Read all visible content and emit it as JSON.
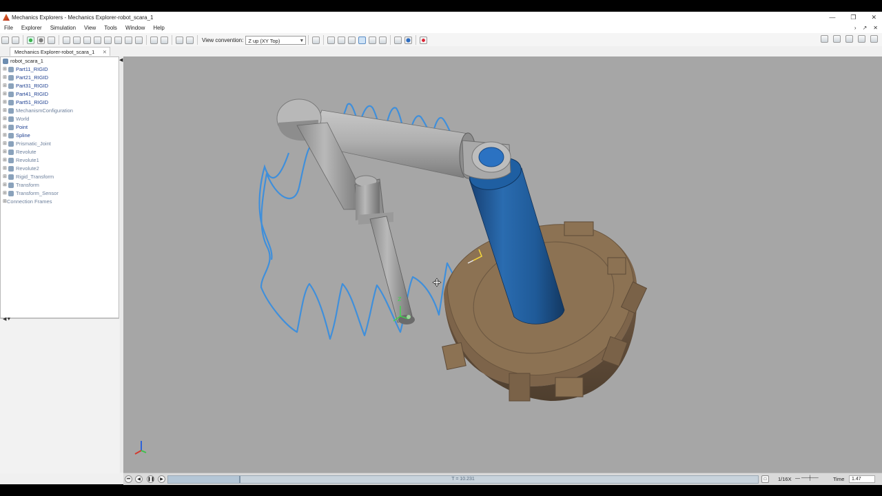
{
  "window": {
    "title": "Mechanics Explorers - Mechanics Explorer-robot_scara_1"
  },
  "menu": {
    "items": [
      "File",
      "Explorer",
      "Simulation",
      "View",
      "Tools",
      "Window",
      "Help"
    ]
  },
  "toolbar": {
    "view_convention_label": "View convention:",
    "view_convention_value": "Z up (XY Top)"
  },
  "tab": {
    "label": "Mechanics Explorer-robot_scara_1"
  },
  "tree": {
    "root": "robot_scara_1",
    "items": [
      {
        "label": "Part11_RIGID",
        "icon": "rigid-body-icon"
      },
      {
        "label": "Part21_RIGID",
        "icon": "rigid-body-icon"
      },
      {
        "label": "Part31_RIGID",
        "icon": "rigid-body-icon"
      },
      {
        "label": "Part41_RIGID",
        "icon": "rigid-body-icon"
      },
      {
        "label": "Part51_RIGID",
        "icon": "rigid-body-icon"
      },
      {
        "label": "MechanismConfiguration",
        "icon": "mechanism-config-icon"
      },
      {
        "label": "World",
        "icon": "world-frame-icon"
      },
      {
        "label": "Point",
        "icon": "point-icon"
      },
      {
        "label": "Spline",
        "icon": "spline-icon"
      },
      {
        "label": "Prismatic_Joint",
        "icon": "prismatic-joint-icon"
      },
      {
        "label": "Revolute",
        "icon": "revolute-joint-icon"
      },
      {
        "label": "Revolute1",
        "icon": "revolute-joint-icon"
      },
      {
        "label": "Revolute2",
        "icon": "revolute-joint-icon"
      },
      {
        "label": "Rigid_Transform",
        "icon": "rigid-transform-icon"
      },
      {
        "label": "Transform",
        "icon": "transform-icon"
      },
      {
        "label": "Transform_Sensor",
        "icon": "transform-sensor-icon"
      },
      {
        "label": "Connection Frames",
        "icon": ""
      }
    ]
  },
  "viewport": {
    "triad_label": "Z",
    "colors": {
      "background": "#a6a6a6",
      "arm": "#a9a9a9",
      "column": "#1f5fa2",
      "gear": "#8c7253",
      "trajectory": "#3f8fdb"
    }
  },
  "playback": {
    "slider_text": "T = 10.231",
    "progress": 0.12,
    "rate": "1/16X",
    "time_label": "Time",
    "time_value": "1.47"
  }
}
